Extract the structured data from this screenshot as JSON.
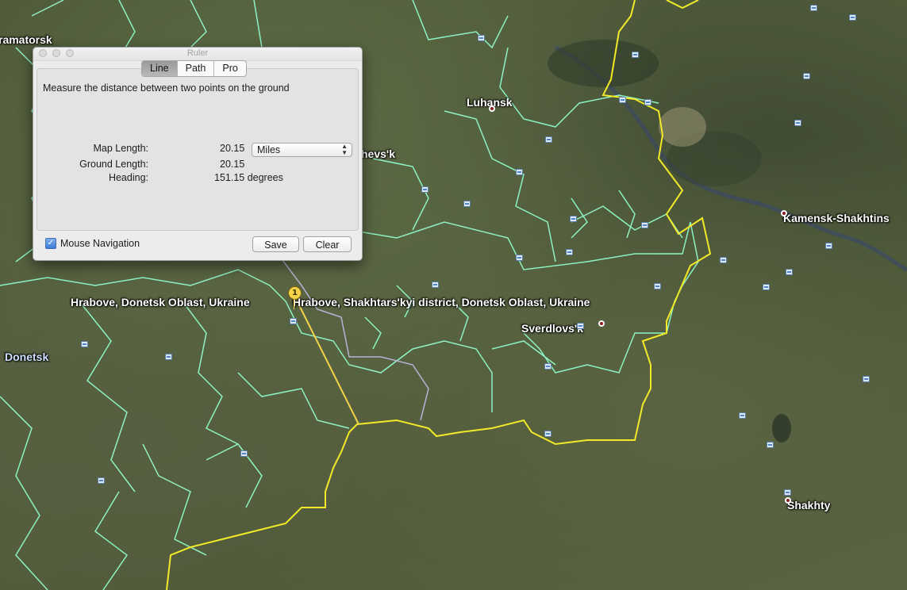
{
  "ruler": {
    "window_title": "Ruler",
    "tabs": [
      "Line",
      "Path",
      "Pro"
    ],
    "active_tab": "Line",
    "instruction": "Measure the distance between two points on the ground",
    "map_length_label": "Map Length:",
    "map_length_value": "20.15",
    "unit_selected": "Miles",
    "ground_length_label": "Ground Length:",
    "ground_length_value": "20.15",
    "heading_label": "Heading:",
    "heading_value": "151.15 degrees",
    "mouse_navigation_label": "Mouse Navigation",
    "mouse_navigation_checked": true,
    "save_label": "Save",
    "clear_label": "Clear"
  },
  "map": {
    "labels": {
      "kramatorsk": "ramatorsk",
      "luhansk": "Luhansk",
      "partial_hevsk": "hevs'k",
      "hrabove_1": "Hrabove, Donetsk Oblast, Ukraine",
      "hrabove_2": "Hrabove, Shakhtars'kyi district, Donetsk Oblast, Ukraine",
      "sverdlovsk": "Sverdlovs'k",
      "donetsk": "Donetsk",
      "kamensk": "Kamensk-Shakhtins",
      "shakhty": "Shakhty"
    },
    "pin_number": "1",
    "colors": {
      "border_yellow": "#f2ea28",
      "boundary_green": "#8df2c3",
      "ruler_line": "#f3d34a",
      "boundary_gray": "#b7b3d6"
    }
  }
}
